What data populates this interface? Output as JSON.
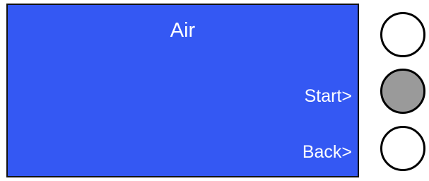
{
  "screen": {
    "title": "Air",
    "start_label": "Start>",
    "back_label": "Back>"
  },
  "buttons": [
    {
      "name": "top",
      "state": "unpressed"
    },
    {
      "name": "middle",
      "state": "pressed"
    },
    {
      "name": "bottom",
      "state": "unpressed"
    }
  ],
  "colors": {
    "screen_background": "#3458f3",
    "screen_text": "#ffffff",
    "button_fill": "#ffffff",
    "button_pressed_fill": "#9a9a9a",
    "button_border": "#000000"
  }
}
